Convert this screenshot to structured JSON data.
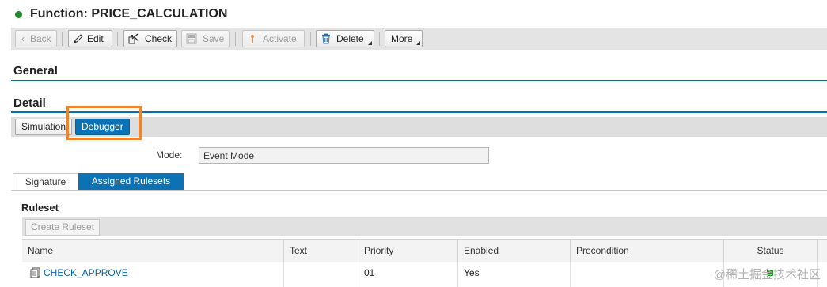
{
  "header": {
    "title": "Function: PRICE_CALCULATION",
    "status_color": "#1f8a2e"
  },
  "toolbar": {
    "back_label": "Back",
    "edit_label": "Edit",
    "check_label": "Check",
    "save_label": "Save",
    "activate_label": "Activate",
    "delete_label": "Delete",
    "more_label": "More"
  },
  "sections": {
    "general": "General",
    "detail": "Detail"
  },
  "detail_tabs": {
    "simulation": "Simulation",
    "debugger": "Debugger"
  },
  "mode": {
    "label": "Mode:",
    "value": "Event Mode"
  },
  "sub_tabs": {
    "signature": "Signature",
    "assigned_rulesets": "Assigned Rulesets"
  },
  "ruleset": {
    "title": "Ruleset",
    "create_label": "Create Ruleset",
    "columns": [
      "Name",
      "Text",
      "Priority",
      "Enabled",
      "Precondition",
      "Status"
    ],
    "rows": [
      {
        "name": "CHECK_APPROVE",
        "text": "",
        "priority": "01",
        "enabled": "Yes",
        "precondition": "",
        "status_color": "#1e8a1e"
      }
    ]
  },
  "watermark": "@稀土掘金技术社区",
  "colors": {
    "accent": "#0b72b5",
    "highlight": "#f0842d"
  }
}
